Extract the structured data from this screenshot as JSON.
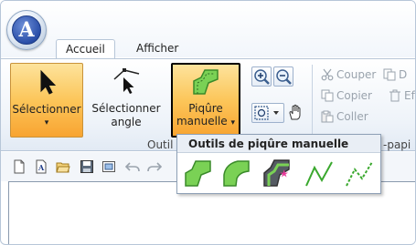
{
  "app": {
    "logo_letter": "A"
  },
  "tabs": [
    {
      "label": "Accueil",
      "active": true
    },
    {
      "label": "Afficher",
      "active": false
    }
  ],
  "ribbon": {
    "select_label_1": "Sélectionner",
    "select_arrow": "▾",
    "angle_label_1": "Sélectionner",
    "angle_label_2": "angle",
    "pique_label_1": "Piqûre",
    "pique_label_2": "manuelle",
    "pique_arrow": "▾",
    "group_tools_partial": "Outil",
    "clipboard_partial": "-papi",
    "clipboard": {
      "cut": "Couper",
      "copy": "Copier",
      "paste": "Coller",
      "dup_partial": "D",
      "eff_partial": "Ef"
    }
  },
  "dropdown": {
    "title": "Outils de piqûre manuelle",
    "items": [
      "arc-piecing-icon",
      "curve-piecing-icon",
      "shape-piecing-icon",
      "line-icon",
      "dotted-line-icon"
    ]
  },
  "colors": {
    "accent_green": "#6cc24a",
    "selected_orange": "#f8a431"
  }
}
